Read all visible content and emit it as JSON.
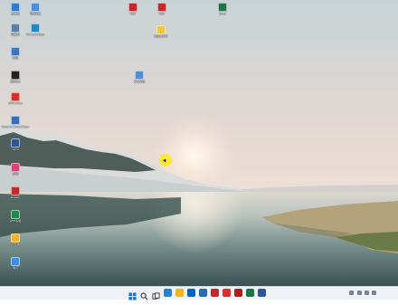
{
  "desktop": {
    "icons": [
      {
        "label": "此电脑",
        "icon": "computer-icon",
        "color": "#2d7dd2"
      },
      {
        "label": "回收站",
        "icon": "recycle-bin-icon",
        "color": "#5b7fa6"
      },
      {
        "label": "网络",
        "icon": "network-icon",
        "color": "#3a78c2"
      },
      {
        "label": "控制面板",
        "icon": "control-panel-icon",
        "color": "#4a90d9"
      },
      {
        "label": "Microsoft Edge",
        "icon": "edge-icon",
        "color": "#1e88c8"
      },
      {
        "label": "腾讯QQ",
        "icon": "qq-icon",
        "color": "#222222"
      },
      {
        "label": "WPS Office",
        "icon": "wps-icon",
        "color": "#d83030"
      },
      {
        "label": "Windows Media Player",
        "icon": "media-player-icon",
        "color": "#3b6fb5"
      },
      {
        "label": "Word",
        "icon": "word-doc-icon",
        "color": "#2b579a"
      },
      {
        "label": "画图",
        "icon": "paint-icon",
        "color": "#e0407a"
      },
      {
        "label": "Reader",
        "icon": "reader-icon",
        "color": "#c02a2a"
      },
      {
        "label": "WPS表格",
        "icon": "spreadsheet-icon",
        "color": "#1f8a4c"
      },
      {
        "label": "文件夹",
        "icon": "folder-icon",
        "color": "#f0b429"
      },
      {
        "label": "网页",
        "icon": "web-shortcut-icon",
        "color": "#3a8ee6"
      },
      {
        "label": "PDF",
        "icon": "pdf-icon",
        "color": "#c8262a"
      },
      {
        "label": "PDF",
        "icon": "pdf-icon",
        "color": "#c8262a"
      },
      {
        "label": "Excel",
        "icon": "excel-icon",
        "color": "#217346"
      },
      {
        "label": "新建文件夹",
        "icon": "folder-icon",
        "color": "#f5c542"
      },
      {
        "label": "文本文档",
        "icon": "text-file-icon",
        "color": "#4f8fd6"
      }
    ]
  },
  "taskbar": {
    "apps": [
      {
        "icon": "start-icon",
        "color": "#1a73e8"
      },
      {
        "icon": "search-icon",
        "color": "#333333"
      },
      {
        "icon": "task-view-icon",
        "color": "#333333"
      },
      {
        "icon": "edge-icon",
        "color": "#1e88c8"
      },
      {
        "icon": "file-explorer-icon",
        "color": "#f0b429"
      },
      {
        "icon": "store-icon",
        "color": "#0067c0"
      },
      {
        "icon": "mail-icon",
        "color": "#2b6cb0"
      },
      {
        "icon": "pdf-icon",
        "color": "#c8262a"
      },
      {
        "icon": "wps-icon",
        "color": "#d83030"
      },
      {
        "icon": "pdf-icon",
        "color": "#b71c1c"
      },
      {
        "icon": "excel-icon",
        "color": "#217346"
      },
      {
        "icon": "word-doc-icon",
        "color": "#2b579a"
      }
    ]
  },
  "colors": {
    "sky_top": "#cfd6d8",
    "sky_mid": "#ead9d2",
    "sun": "#fff6ea",
    "water_top": "#e4dccf",
    "water_bottom": "#3f5a5c",
    "cursor_highlight": "#ffeb00"
  }
}
